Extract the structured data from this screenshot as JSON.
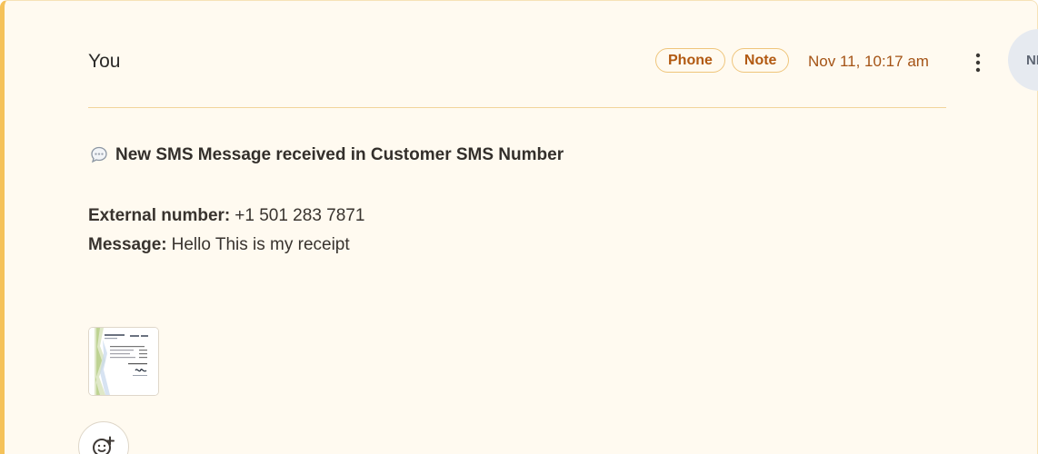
{
  "note": {
    "author": "You",
    "tags": [
      "Phone",
      "Note"
    ],
    "timestamp": "Nov 11, 10:17 am",
    "avatar_initials": "NM",
    "headline": "New SMS Message received in Customer SMS Number",
    "external_number_label": "External number:",
    "external_number_value": "+1 501 283 7871",
    "message_label": "Message:",
    "message_value": "Hello This is my receipt",
    "attachment_icon": "receipt-thumbnail",
    "more_icon": "vertical-dots-icon",
    "reaction_icon": "emoji-add-icon",
    "headline_icon": "speech-bubble-icon"
  },
  "colors": {
    "card_background": "#fffaf0",
    "left_accent": "#f5c25a",
    "tag_text": "#b25a12",
    "tag_border": "#efc57b",
    "timestamp": "#a45315",
    "avatar_background": "#e6eaf0"
  }
}
